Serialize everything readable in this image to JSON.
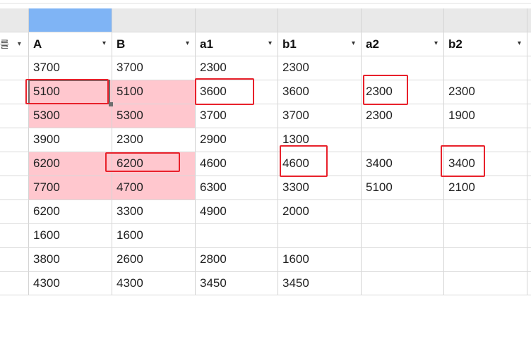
{
  "left_header_fragment": "를",
  "left_header_arrow": "▾",
  "columns": [
    {
      "header": "A",
      "arrow": "▾"
    },
    {
      "header": "B",
      "arrow": "▾"
    },
    {
      "header": "a1",
      "arrow": "▾"
    },
    {
      "header": "b1",
      "arrow": "▾"
    },
    {
      "header": "a2",
      "arrow": "▾"
    },
    {
      "header": "b2",
      "arrow": "▾"
    }
  ],
  "rows": [
    [
      "3700",
      "3700",
      "2300",
      "2300",
      "",
      ""
    ],
    [
      "5100",
      "5100",
      "3600",
      "3600",
      "2300",
      "2300"
    ],
    [
      "5300",
      "5300",
      "3700",
      "3700",
      "2300",
      "1900"
    ],
    [
      "3900",
      "2300",
      "2900",
      "1300",
      "",
      ""
    ],
    [
      "6200",
      "6200",
      "4600",
      "4600",
      "3400",
      "3400"
    ],
    [
      "7700",
      "4700",
      "6300",
      "3300",
      "5100",
      "2100"
    ],
    [
      "6200",
      "3300",
      "4900",
      "2000",
      "",
      ""
    ],
    [
      "1600",
      "1600",
      "",
      "",
      "",
      ""
    ],
    [
      "3800",
      "2600",
      "2800",
      "1600",
      "",
      ""
    ],
    [
      "4300",
      "4300",
      "3450",
      "3450",
      "",
      ""
    ]
  ],
  "colors": {
    "selected_column_header": "#7fb4f5",
    "conditional_highlight": "#ffc7ce",
    "annotation_box": "#e8212b"
  }
}
